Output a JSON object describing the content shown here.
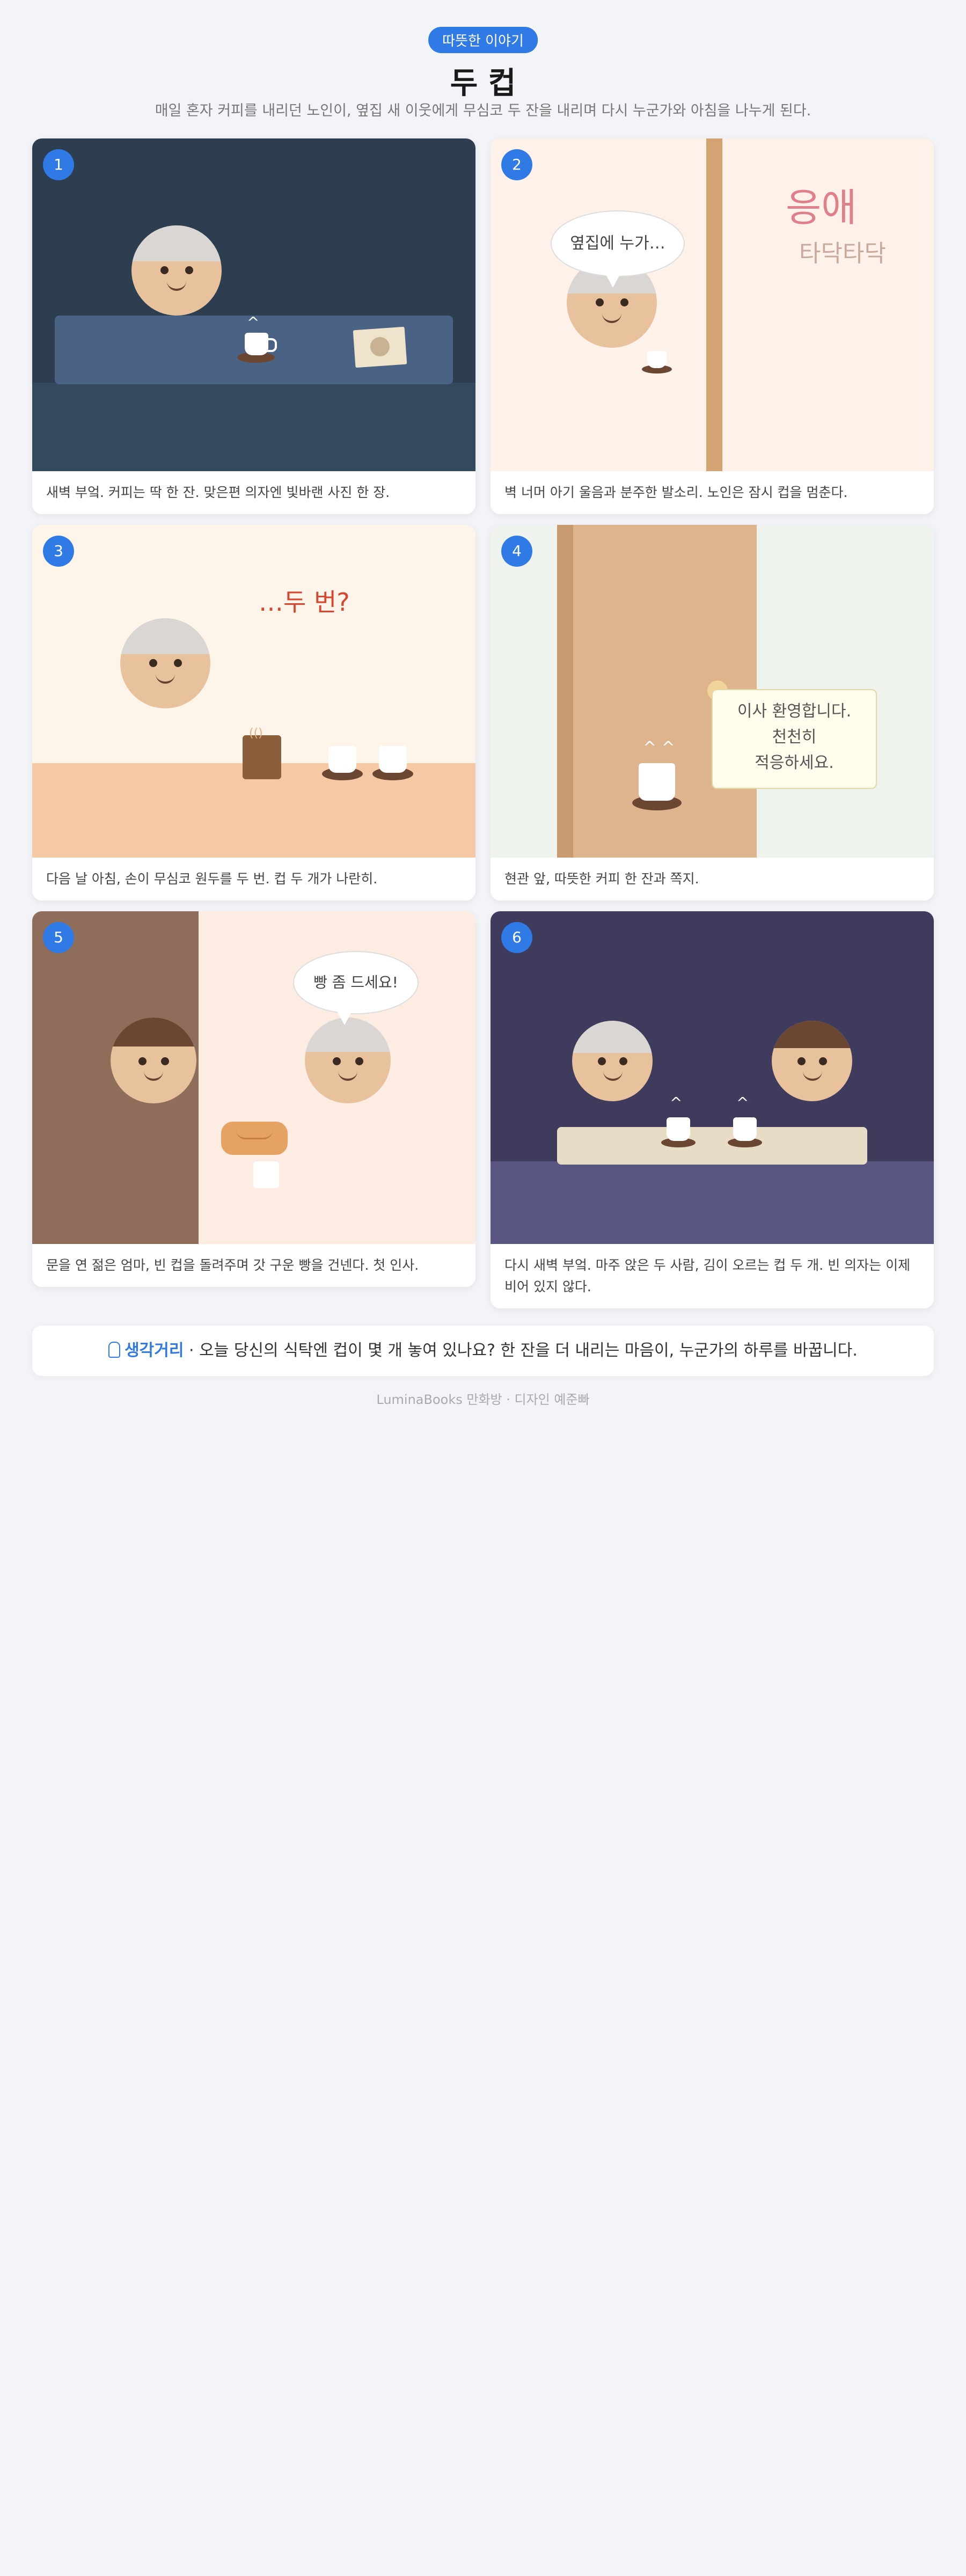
{
  "header": {
    "badge": "따뜻한 이야기",
    "title": "두 컵",
    "subtitle": "매일 혼자 커피를 내리던 노인이, 옆집 새 이웃에게 무심코 두 잔을 내리며 다시 누군가와 아침을 나누게 된다."
  },
  "panels": [
    {
      "number": "1",
      "caption": "새벽 부엌. 커피는 딱 한 잔. 맞은편 의자엔 빛바랜 사진 한 장."
    },
    {
      "number": "2",
      "bubble": "옆집에 누가…",
      "sfx_1": "응애",
      "sfx_2": "타닥타닥",
      "caption": "벽 너머 아기 울음과 분주한 발소리. 노인은 잠시 컵을 멈춘다."
    },
    {
      "number": "3",
      "thought": "…두 번?",
      "caption": "다음 날 아침, 손이 무심코 원두를 두 번. 컵 두 개가 나란히."
    },
    {
      "number": "4",
      "note_line_1": "이사 환영합니다.",
      "note_line_2": "천천히",
      "note_line_3": "적응하세요.",
      "caption": "현관 앞, 따뜻한 커피 한 잔과 쪽지."
    },
    {
      "number": "5",
      "bubble": "빵 좀 드세요!",
      "caption": "문을 연 젊은 엄마, 빈 컵을 돌려주며 갓 구운 빵을 건넨다. 첫 인사."
    },
    {
      "number": "6",
      "caption": "다시 새벽 부엌. 마주 앉은 두 사람, 김이 오르는 컵 두 개. 빈 의자는 이제 비어 있지 않다."
    }
  ],
  "footer": {
    "icon": "lightbulb-icon",
    "lead": "생각거리",
    "text": " · 오늘 당신의 식탁엔 컵이 몇 개 놓여 있나요? 한 잔을 더 내리는 마음이, 누군가의 하루를 바꿉니다.",
    "credit": "LuminaBooks 만화방 · 디자인 예준빠"
  },
  "colors": {
    "accent": "#2f7ae5",
    "night_bg": "#2c3e50",
    "warm_bg": "#fdf1e9",
    "dawn_bg": "#3e3b5c"
  }
}
